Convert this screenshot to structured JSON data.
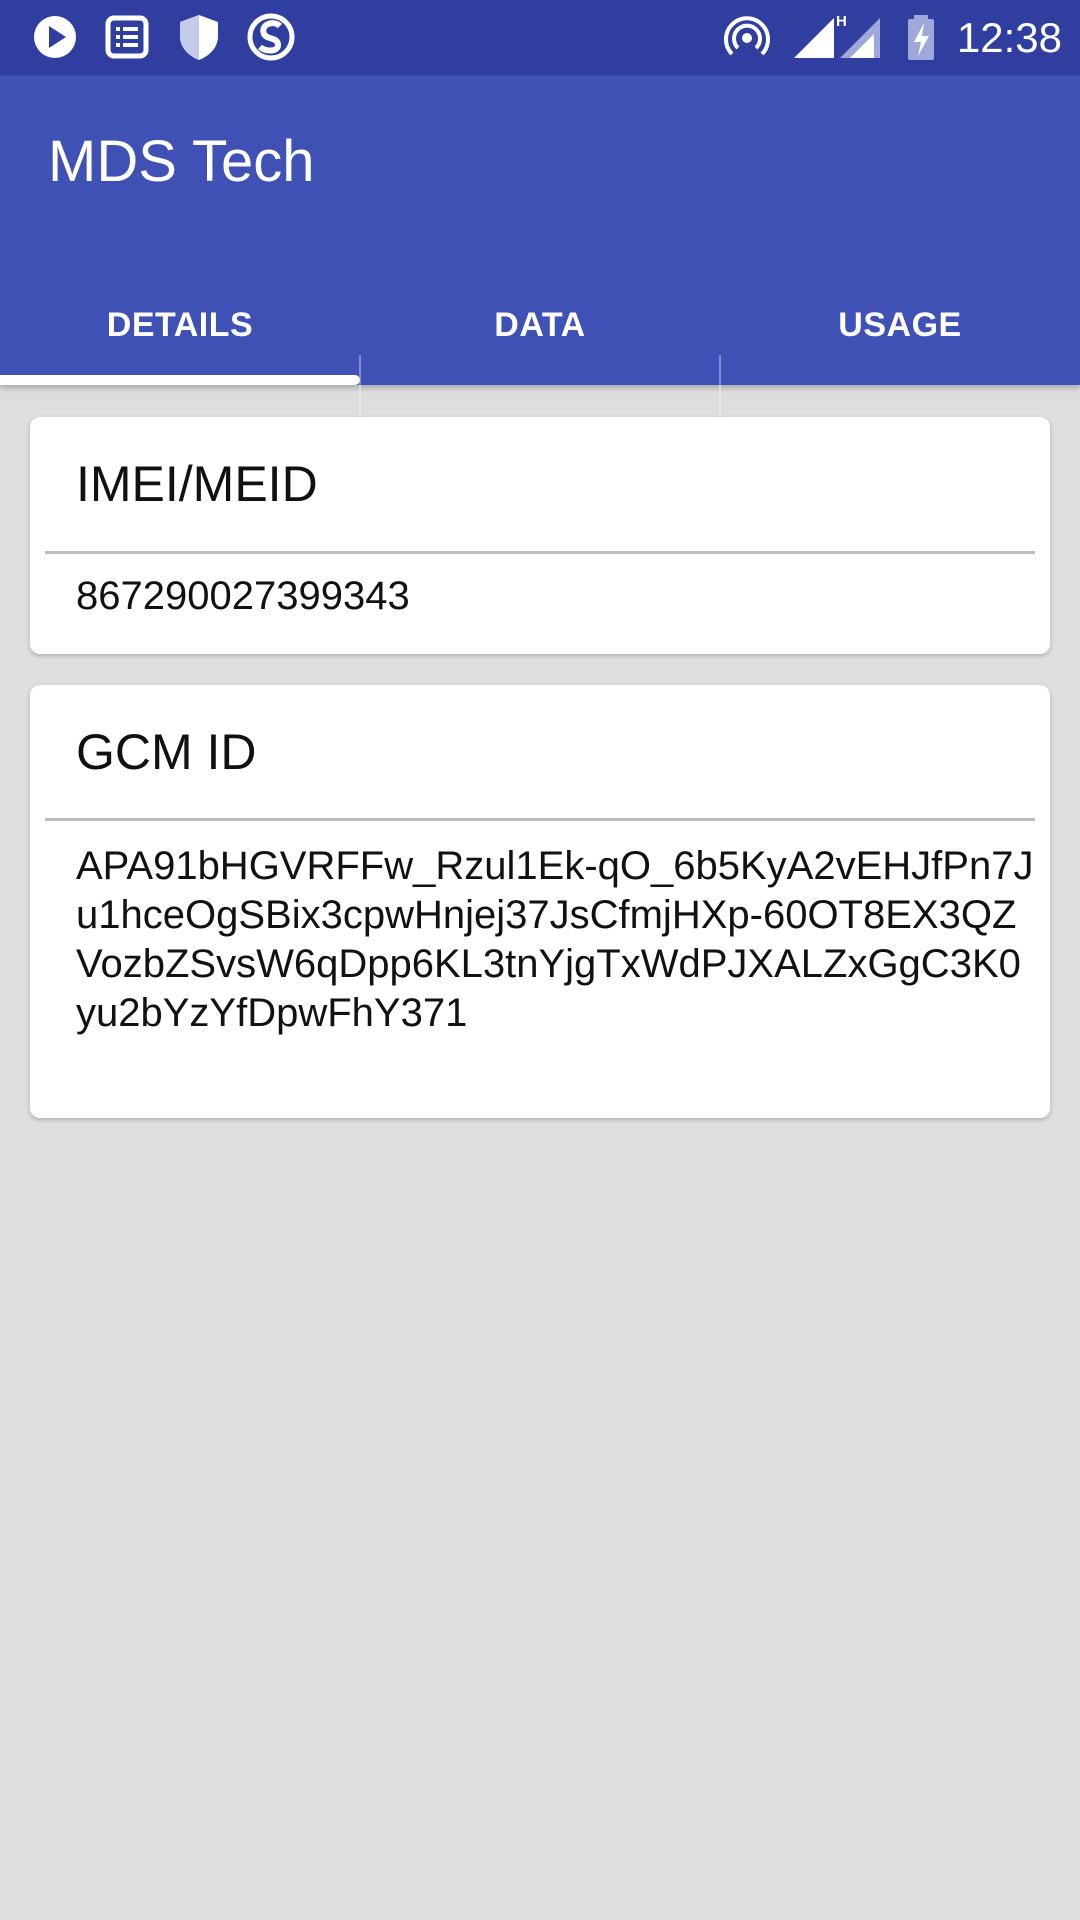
{
  "status_bar": {
    "time": "12:38",
    "icons": [
      "play-circle-icon",
      "list-icon",
      "shield-icon",
      "s-logo-icon",
      "hotspot-icon",
      "signal-icon",
      "signal-h-icon",
      "battery-charging-icon"
    ]
  },
  "app": {
    "title": "MDS Tech",
    "primary_color": "#3f51b5",
    "status_color": "#303f9f"
  },
  "tabs": [
    {
      "label": "DETAILS",
      "selected": true
    },
    {
      "label": "DATA",
      "selected": false
    },
    {
      "label": "USAGE",
      "selected": false
    }
  ],
  "cards": {
    "imei": {
      "title": "IMEI/MEID",
      "value": "867290027399343"
    },
    "gcm": {
      "title": "GCM ID",
      "value": "APA91bHGVRFFw_Rzul1Ek-qO_6b5KyA2vEHJfPn7Ju1hceOgSBix3cpwHnjej37JsCfmjHXp-60OT8EX3QZVozbZSvsW6qDpp6KL3tnYjgTxWdPJXALZxGgC3K0yu2bYzYfDpwFhY371"
    }
  }
}
